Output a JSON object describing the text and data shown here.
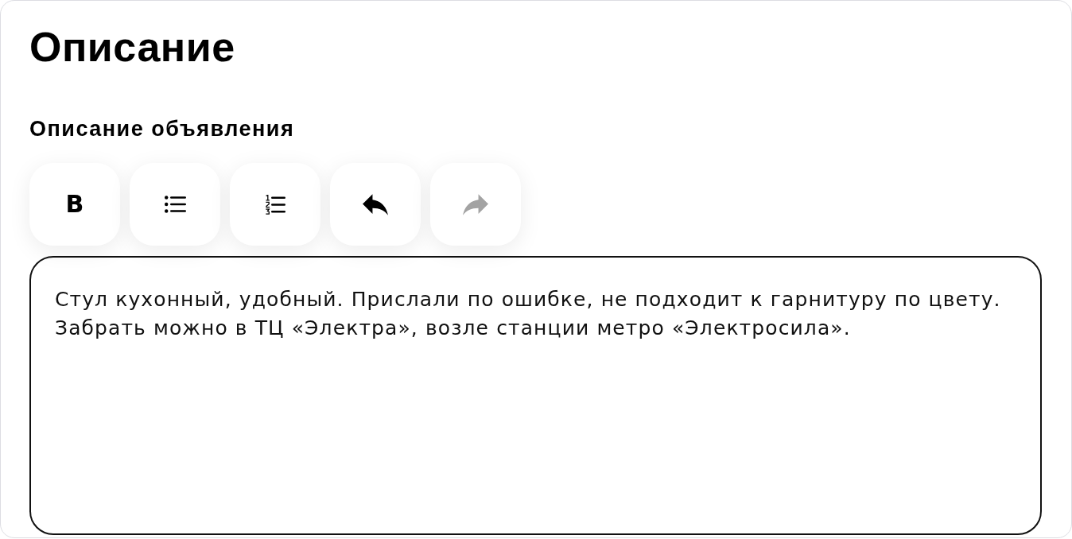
{
  "section": {
    "title": "Описание"
  },
  "field": {
    "label": "Описание объявления"
  },
  "toolbar": [
    {
      "kind": "bold",
      "label": "B",
      "disabled": false
    },
    {
      "kind": "bullet-list",
      "disabled": false
    },
    {
      "kind": "numbered-list",
      "disabled": false
    },
    {
      "kind": "undo",
      "disabled": false
    },
    {
      "kind": "redo",
      "disabled": true
    }
  ],
  "description": {
    "value": "Стул кухонный, удобный. Прислали по ошибке, не подходит к гарнитуру по цвету. Забрать можно в ТЦ «Электра», возле станции метро «Электросила»."
  }
}
